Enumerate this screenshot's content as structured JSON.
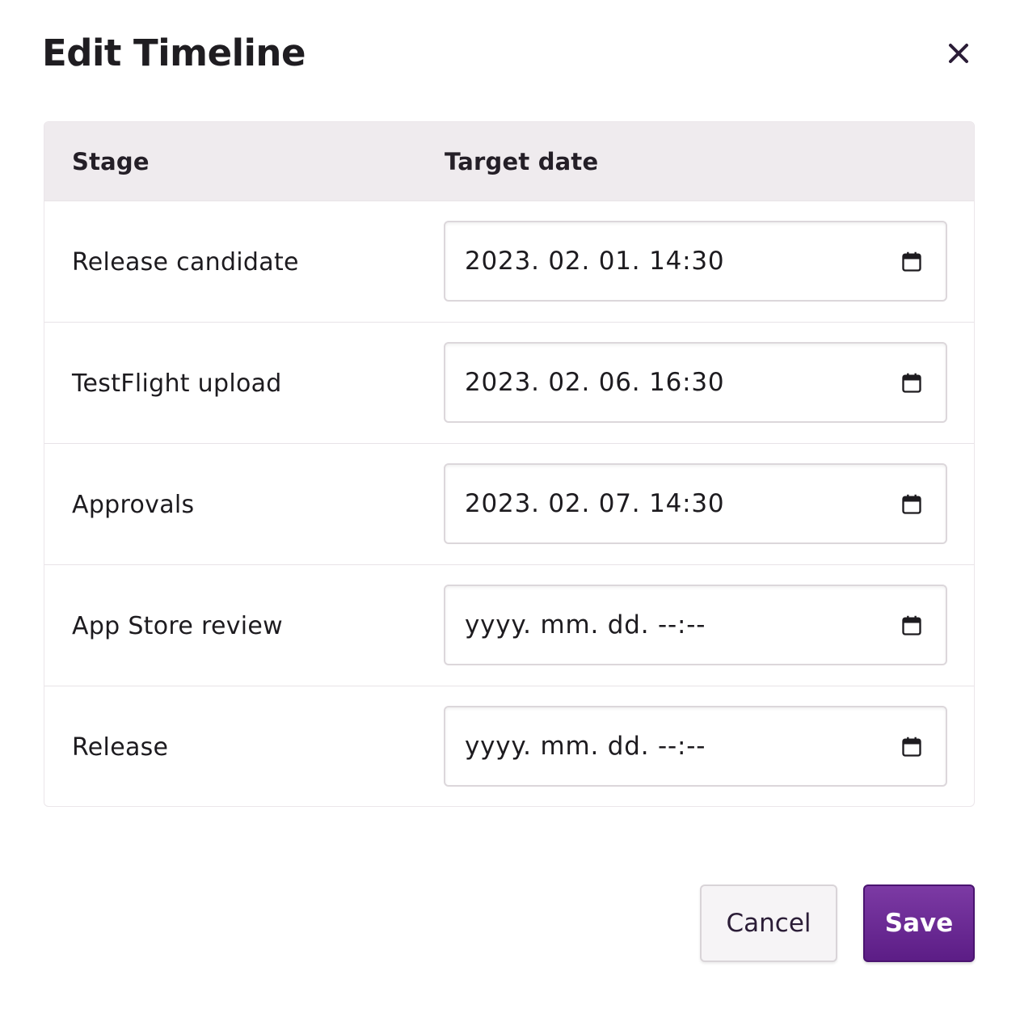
{
  "dialog": {
    "title": "Edit Timeline",
    "close_icon": "close-icon"
  },
  "table": {
    "headers": [
      "Stage",
      "Target date"
    ],
    "rows": [
      {
        "stage": "Release candidate",
        "date": "2023. 02. 01. 14:30"
      },
      {
        "stage": "TestFlight upload",
        "date": "2023. 02. 06. 16:30"
      },
      {
        "stage": "Approvals",
        "date": "2023. 02. 07. 14:30"
      },
      {
        "stage": "App Store review",
        "date": "yyyy. mm. dd. --:--"
      },
      {
        "stage": "Release",
        "date": "yyyy. mm. dd. --:--"
      }
    ],
    "calendar_icon": "calendar-icon"
  },
  "footer": {
    "cancel_label": "Cancel",
    "save_label": "Save"
  },
  "colors": {
    "primary": "#6a2896",
    "header_bg": "#efebee",
    "text": "#1d1b1f"
  }
}
